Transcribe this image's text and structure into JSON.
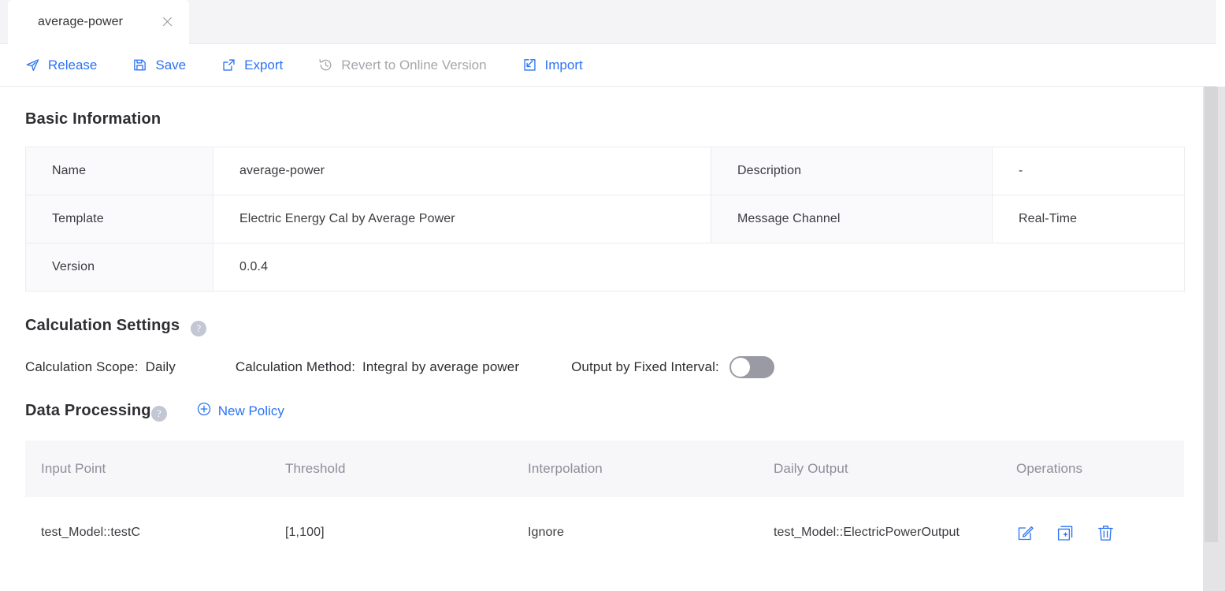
{
  "tab": {
    "label": "average-power",
    "close_icon": "close-icon"
  },
  "toolbar": {
    "buttons": [
      {
        "label": "Release",
        "icon": "send-icon",
        "disabled": false
      },
      {
        "label": "Save",
        "icon": "floppy-disk-icon",
        "disabled": false
      },
      {
        "label": "Export",
        "icon": "external-link-icon",
        "disabled": false
      },
      {
        "label": "Revert to Online Version",
        "icon": "history-clock-icon",
        "disabled": true
      },
      {
        "label": "Import",
        "icon": "import-box-icon",
        "disabled": false
      }
    ],
    "accent_color": "#2b72f4",
    "disabled_color": "#a6a6ad"
  },
  "basic_information": {
    "title": "Basic Information",
    "rows": [
      {
        "label1": "Name",
        "value1": "average-power",
        "label2": "Description",
        "value2": "-"
      },
      {
        "label1": "Template",
        "value1": "Electric Energy Cal by Average Power",
        "label2": "Message Channel",
        "value2": "Real-Time"
      },
      {
        "label1": "Version",
        "value1": "0.0.4",
        "label2": "",
        "value2": ""
      }
    ]
  },
  "calculation_settings": {
    "title": "Calculation Settings",
    "help_icon": "question-mark-icon",
    "scope_label": "Calculation Scope:",
    "scope_value": "Daily",
    "method_label": "Calculation Method:",
    "method_value": "Integral by average power",
    "fixed_interval_label": "Output by Fixed Interval:",
    "fixed_interval_on": false
  },
  "data_processing": {
    "title": "Data Processing",
    "help_icon": "question-mark-icon",
    "new_policy_label": "New Policy",
    "new_policy_icon": "plus-circle-icon",
    "columns": [
      "Input Point",
      "Threshold",
      "Interpolation",
      "Daily Output",
      "Operations"
    ],
    "rows": [
      {
        "input_point": "test_Model::testC",
        "threshold": "[1,100]",
        "interpolation": "Ignore",
        "daily_output": "test_Model::ElectricPowerOutput",
        "operations": [
          "edit-icon",
          "copy-icon",
          "delete-icon"
        ]
      }
    ]
  },
  "scrollbar": {
    "orientation": "vertical",
    "position": "top"
  }
}
